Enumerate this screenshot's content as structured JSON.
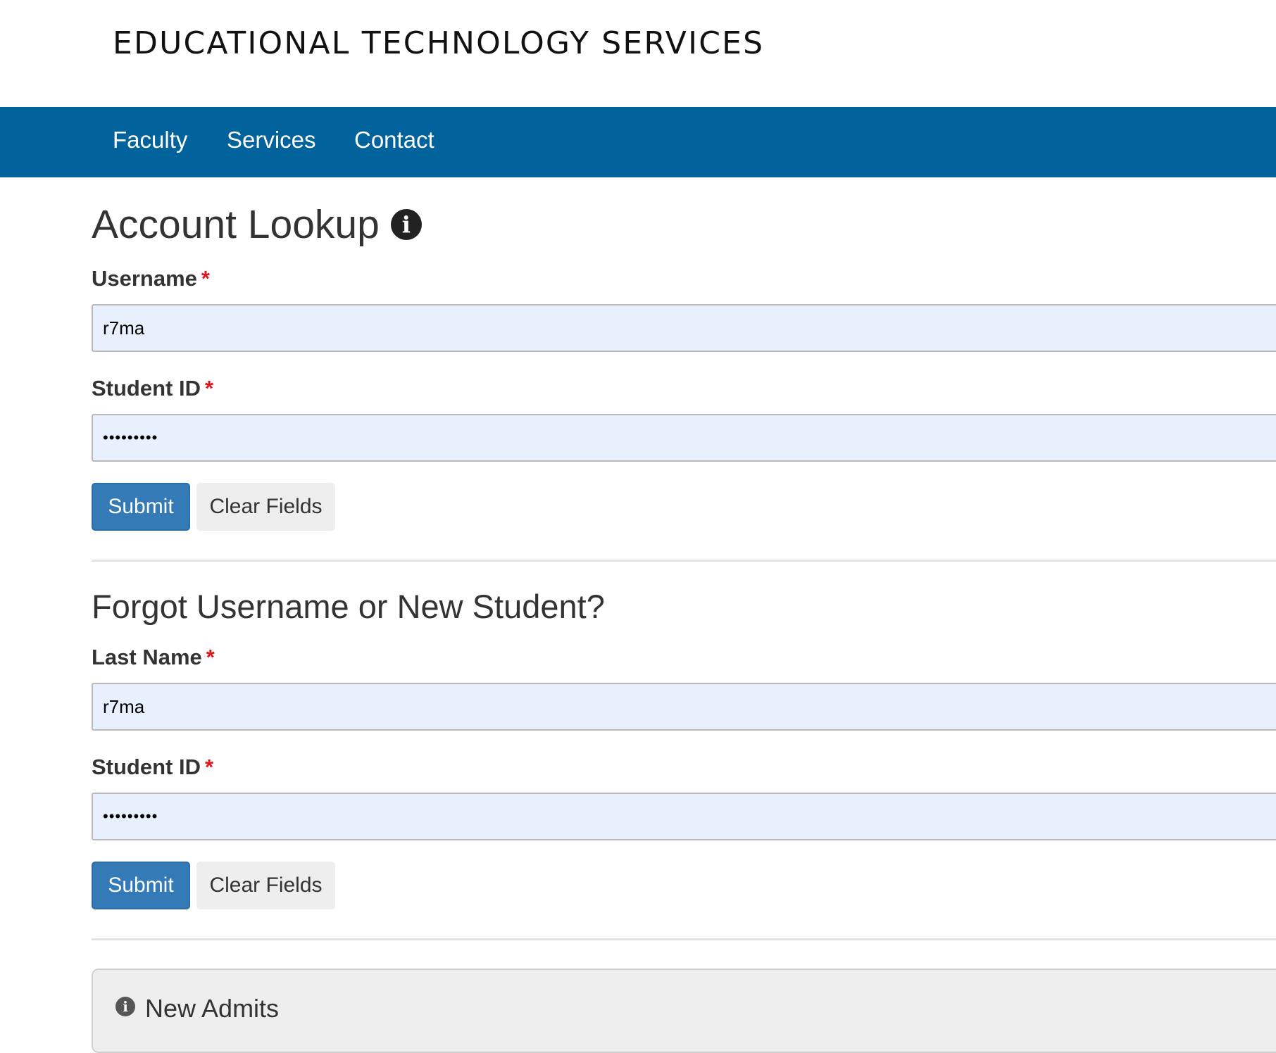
{
  "header": {
    "site_title": "EDUCATIONAL TECHNOLOGY SERVICES"
  },
  "nav": {
    "items": [
      {
        "label": "Faculty"
      },
      {
        "label": "Services"
      },
      {
        "label": "Contact"
      }
    ]
  },
  "account_lookup": {
    "title": "Account Lookup",
    "info_icon": "info-circle-icon",
    "username": {
      "label": "Username",
      "required_mark": "*",
      "value": "r7ma"
    },
    "student_id": {
      "label": "Student ID",
      "required_mark": "*",
      "value": "•••••••••"
    },
    "submit_label": "Submit",
    "clear_label": "Clear Fields"
  },
  "forgot": {
    "title": "Forgot Username or New Student?",
    "last_name": {
      "label": "Last Name",
      "required_mark": "*",
      "value": "r7ma"
    },
    "student_id": {
      "label": "Student ID",
      "required_mark": "*",
      "value": "•••••••••"
    },
    "submit_label": "Submit",
    "clear_label": "Clear Fields"
  },
  "new_admits": {
    "icon": "info-circle-icon",
    "title": "New Admits"
  },
  "colors": {
    "nav_bg": "#02629b",
    "primary_button": "#337ab7",
    "required": "#e0161b",
    "autofill_bg": "#e8f0fe"
  }
}
